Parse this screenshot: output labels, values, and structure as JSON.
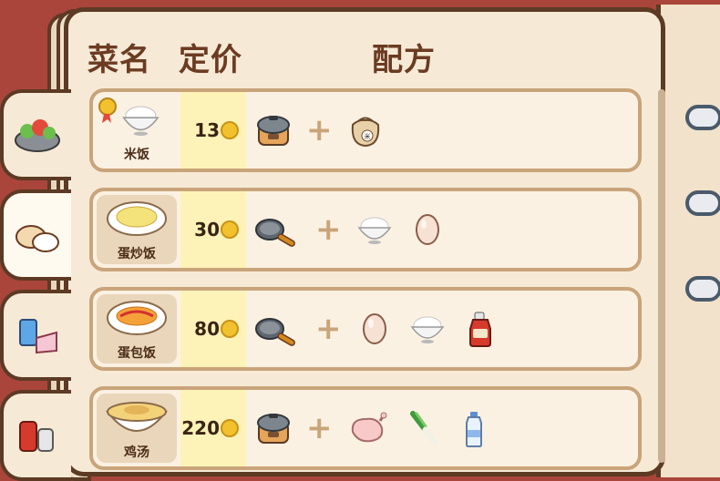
{
  "header": {
    "dish_col": "菜名",
    "price_col": "定价",
    "recipe_col": "配方"
  },
  "tabs": [
    {
      "icon": "salad-icon"
    },
    {
      "icon": "rice-bowls-icon"
    },
    {
      "icon": "drink-cake-icon"
    },
    {
      "icon": "sauce-bottles-icon"
    }
  ],
  "recipes": [
    {
      "name": "米饭",
      "price": "13",
      "dish_icon": "rice-bowl-icon",
      "ingredients": [
        "rice-cooker-icon",
        "rice-sack-icon"
      ],
      "sack_label": "米"
    },
    {
      "name": "蛋炒饭",
      "price": "30",
      "dish_icon": "fried-rice-icon",
      "ingredients": [
        "frying-pan-icon",
        "rice-bowl-icon",
        "egg-icon"
      ]
    },
    {
      "name": "蛋包饭",
      "price": "80",
      "dish_icon": "omelette-rice-icon",
      "ingredients": [
        "frying-pan-icon",
        "egg-icon",
        "rice-bowl-icon",
        "ketchup-bottle-icon"
      ]
    },
    {
      "name": "鸡汤",
      "price": "220",
      "dish_icon": "chicken-soup-icon",
      "ingredients": [
        "rice-cooker-icon",
        "raw-chicken-icon",
        "green-onion-icon",
        "water-bottle-icon"
      ]
    }
  ],
  "plus": "+",
  "colors": {
    "frame": "#5c3a24",
    "page": "#f6ead6",
    "row_border": "#c9a47a",
    "price_bg": "#fdf3b8",
    "coin": "#f2c12e",
    "header_text": "#6b3b22"
  }
}
